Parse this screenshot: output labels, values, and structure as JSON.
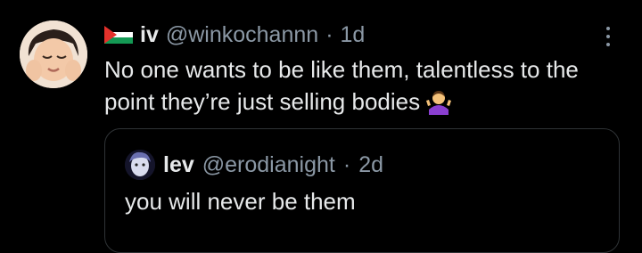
{
  "tweet": {
    "author": {
      "display_name": "iv",
      "handle": "@winkochannn",
      "separator": "·",
      "time": "1d",
      "flag_icon": "palestine-flag-icon"
    },
    "text": "No one wants to be like them, talentless to the point they’re just selling bodies",
    "emoji": "person-shrugging-emoji",
    "more_icon": "more-options-icon"
  },
  "quote": {
    "author": {
      "display_name": "lev",
      "handle": "@erodianight",
      "separator": "·",
      "time": "2d"
    },
    "text": "you will never be them"
  },
  "colors": {
    "background": "#000000",
    "text_primary": "#e7e9ea",
    "text_secondary": "#8b98a5",
    "border": "#2f3336"
  }
}
